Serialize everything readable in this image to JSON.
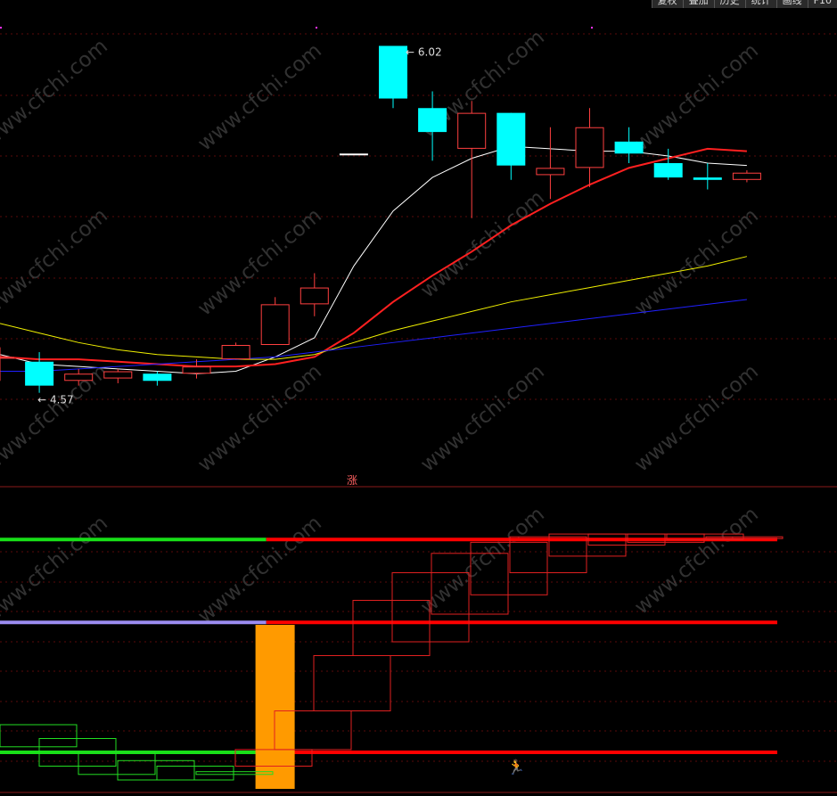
{
  "toolbar": {
    "buttons": [
      "复权",
      "叠加",
      "历史",
      "统计",
      "画线",
      "F10"
    ]
  },
  "watermark": "www.cfchi.com",
  "signal_text": "涨",
  "chart_data": [
    {
      "type": "candlestick",
      "title": "",
      "ylim": [
        4.2,
        6.1
      ],
      "max_label": "6.02",
      "min_label": "4.57",
      "candles": [
        {
          "o": 4.72,
          "h": 4.76,
          "l": 4.62,
          "c": 4.72,
          "color": "red"
        },
        {
          "o": 4.7,
          "h": 4.74,
          "l": 4.57,
          "c": 4.6,
          "color": "cyan"
        },
        {
          "o": 4.62,
          "h": 4.67,
          "l": 4.6,
          "c": 4.65,
          "color": "red"
        },
        {
          "o": 4.63,
          "h": 4.67,
          "l": 4.61,
          "c": 4.66,
          "color": "red"
        },
        {
          "o": 4.65,
          "h": 4.66,
          "l": 4.6,
          "c": 4.62,
          "color": "cyan"
        },
        {
          "o": 4.65,
          "h": 4.71,
          "l": 4.63,
          "c": 4.68,
          "color": "red"
        },
        {
          "o": 4.71,
          "h": 4.78,
          "l": 4.71,
          "c": 4.77,
          "color": "red"
        },
        {
          "o": 4.77,
          "h": 4.97,
          "l": 4.77,
          "c": 4.94,
          "color": "red"
        },
        {
          "o": 4.94,
          "h": 5.07,
          "l": 4.89,
          "c": 5.01,
          "color": "red"
        },
        {
          "o": 5.57,
          "h": 5.57,
          "l": 5.57,
          "c": 5.57,
          "color": "white"
        },
        {
          "o": 6.02,
          "h": 6.02,
          "l": 5.76,
          "c": 5.8,
          "color": "cyan"
        },
        {
          "o": 5.76,
          "h": 5.83,
          "l": 5.54,
          "c": 5.66,
          "color": "cyan"
        },
        {
          "o": 5.59,
          "h": 5.79,
          "l": 5.3,
          "c": 5.74,
          "color": "red"
        },
        {
          "o": 5.74,
          "h": 5.74,
          "l": 5.46,
          "c": 5.52,
          "color": "cyan"
        },
        {
          "o": 5.48,
          "h": 5.68,
          "l": 5.38,
          "c": 5.51,
          "color": "red"
        },
        {
          "o": 5.51,
          "h": 5.76,
          "l": 5.43,
          "c": 5.68,
          "color": "red"
        },
        {
          "o": 5.62,
          "h": 5.68,
          "l": 5.53,
          "c": 5.57,
          "color": "cyan"
        },
        {
          "o": 5.53,
          "h": 5.59,
          "l": 5.46,
          "c": 5.47,
          "color": "cyan"
        },
        {
          "o": 5.47,
          "h": 5.53,
          "l": 5.42,
          "c": 5.46,
          "color": "cyan"
        },
        {
          "o": 5.46,
          "h": 5.5,
          "l": 5.45,
          "c": 5.49,
          "color": "red"
        }
      ],
      "moving_averages": [
        {
          "color": "#ffffff",
          "values": [
            4.73,
            4.69,
            4.68,
            4.67,
            4.66,
            4.65,
            4.66,
            4.72,
            4.8,
            5.1,
            5.33,
            5.47,
            5.55,
            5.6,
            5.59,
            5.58,
            5.58,
            5.56,
            5.53,
            5.52
          ]
        },
        {
          "color": "#ff2020",
          "values": [
            4.72,
            4.71,
            4.71,
            4.7,
            4.69,
            4.68,
            4.68,
            4.69,
            4.72,
            4.82,
            4.95,
            5.06,
            5.16,
            5.27,
            5.36,
            5.44,
            5.51,
            5.55,
            5.59,
            5.58
          ]
        },
        {
          "color": "#f0f000",
          "values": [
            4.86,
            4.82,
            4.78,
            4.75,
            4.73,
            4.72,
            4.71,
            4.71,
            4.73,
            4.78,
            4.83,
            4.87,
            4.91,
            4.95,
            4.98,
            5.01,
            5.04,
            5.07,
            5.1,
            5.14
          ]
        },
        {
          "color": "#2020ff",
          "values": [
            4.66,
            4.66,
            4.67,
            4.68,
            4.69,
            4.7,
            4.71,
            4.72,
            4.74,
            4.76,
            4.78,
            4.8,
            4.82,
            4.84,
            4.86,
            4.88,
            4.9,
            4.92,
            4.94,
            4.96
          ]
        }
      ]
    },
    {
      "type": "indicator",
      "ylim": [
        0,
        100
      ],
      "levels": [
        {
          "value": 87,
          "color_left": "#18e018",
          "color_right": "#ff0000",
          "switch_index": 7
        },
        {
          "value": 57,
          "color_left": "#9b8cf0",
          "color_right": "#ff0000",
          "switch_index": 7
        },
        {
          "value": 10,
          "color_left": "#18e018",
          "color_right": "#ff0000",
          "switch_index": 7
        }
      ],
      "boxes": [
        {
          "a": 20,
          "b": 12,
          "color": "green"
        },
        {
          "a": 15,
          "b": 5,
          "color": "green"
        },
        {
          "a": 10,
          "b": 2,
          "color": "green"
        },
        {
          "a": 7,
          "b": 0,
          "color": "green"
        },
        {
          "a": 5,
          "b": 0,
          "color": "green"
        },
        {
          "a": 3,
          "b": 2,
          "color": "green"
        },
        {
          "a": 11,
          "b": 5,
          "color": "red"
        },
        {
          "a": 25,
          "b": 11,
          "color": "red"
        },
        {
          "a": 45,
          "b": 25,
          "color": "red"
        },
        {
          "a": 65,
          "b": 45,
          "color": "red"
        },
        {
          "a": 75,
          "b": 50,
          "color": "red"
        },
        {
          "a": 82,
          "b": 60,
          "color": "red"
        },
        {
          "a": 86,
          "b": 67,
          "color": "red"
        },
        {
          "a": 88,
          "b": 75,
          "color": "red"
        },
        {
          "a": 89,
          "b": 81,
          "color": "red"
        },
        {
          "a": 89,
          "b": 85,
          "color": "red"
        },
        {
          "a": 89,
          "b": 86,
          "color": "red"
        },
        {
          "a": 89,
          "b": 87,
          "color": "red"
        },
        {
          "a": 88,
          "b": 88,
          "color": "red"
        }
      ],
      "highlight_index": 6,
      "signal_index": 12
    }
  ]
}
